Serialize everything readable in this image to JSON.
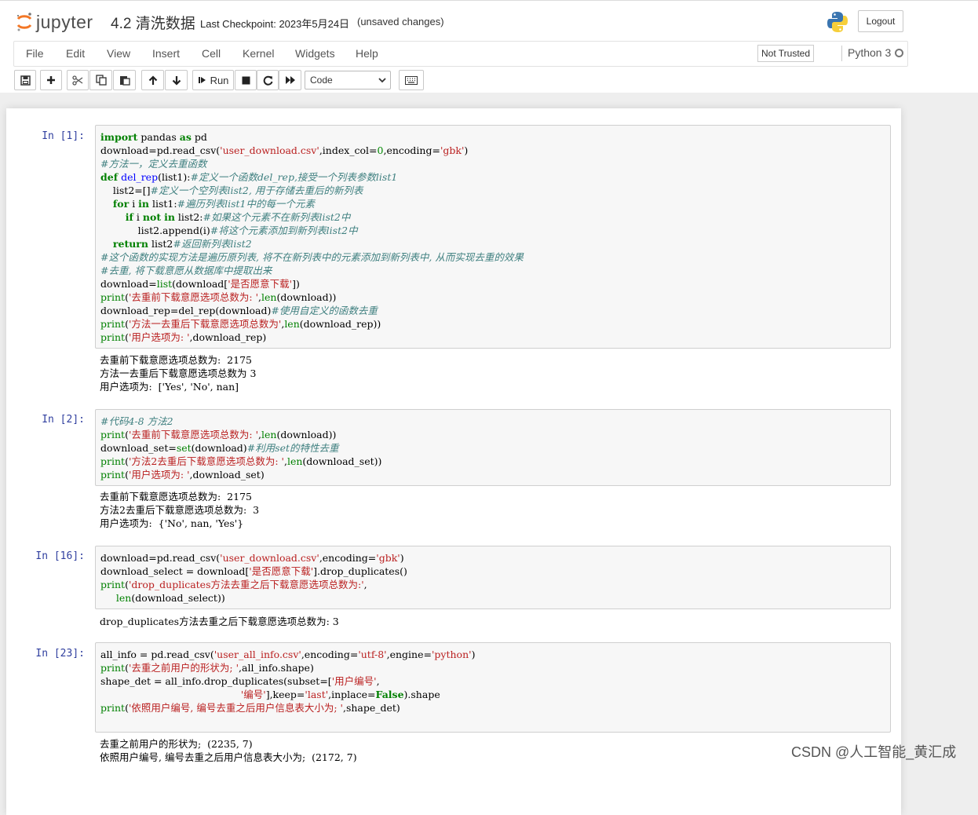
{
  "header": {
    "logo_text": "jupyter",
    "notebook_name": "4.2 清洗数据",
    "checkpoint": "Last Checkpoint: 2023年5月24日",
    "unsaved": "(unsaved changes)",
    "logout_label": "Logout"
  },
  "menu": {
    "items": [
      "File",
      "Edit",
      "View",
      "Insert",
      "Cell",
      "Kernel",
      "Widgets",
      "Help"
    ],
    "trusted": "Not Trusted",
    "kernel": "Python 3"
  },
  "toolbar": {
    "run_label": "Run",
    "cell_type": "Code"
  },
  "cells": [
    {
      "prompt": "In  [1]:",
      "code": [
        [
          [
            "k",
            "import"
          ],
          [
            "n",
            " pandas "
          ],
          [
            "k",
            "as"
          ],
          [
            "n",
            " pd"
          ]
        ],
        [
          [
            "n",
            "download=pd.read_csv("
          ],
          [
            "s",
            "'user_download.csv'"
          ],
          [
            "n",
            ",index_col="
          ],
          [
            "num",
            "0"
          ],
          [
            "n",
            ",encoding="
          ],
          [
            "s",
            "'gbk'"
          ],
          [
            "n",
            ")"
          ]
        ],
        [
          [
            "c",
            "#方法一，定义去重函数"
          ]
        ],
        [
          [
            "k",
            "def"
          ],
          [
            "n",
            " "
          ],
          [
            "f",
            "del_rep"
          ],
          [
            "n",
            "(list1):"
          ],
          [
            "c",
            "#定义一个函数del_rep,接受一个列表参数list1"
          ]
        ],
        [
          [
            "n",
            "    list2=[]"
          ],
          [
            "c",
            "#定义一个空列表list2, 用于存储去重后的新列表"
          ]
        ],
        [
          [
            "n",
            "    "
          ],
          [
            "k",
            "for"
          ],
          [
            "n",
            " i "
          ],
          [
            "k",
            "in"
          ],
          [
            "n",
            " list1:"
          ],
          [
            "c",
            "#遍历列表list1中的每一个元素"
          ]
        ],
        [
          [
            "n",
            "        "
          ],
          [
            "k",
            "if"
          ],
          [
            "n",
            " i "
          ],
          [
            "k",
            "not"
          ],
          [
            "n",
            " "
          ],
          [
            "k",
            "in"
          ],
          [
            "n",
            " list2:"
          ],
          [
            "c",
            "#如果这个元素不在新列表list2中"
          ]
        ],
        [
          [
            "n",
            "            list2.append(i)"
          ],
          [
            "c",
            "#将这个元素添加到新列表list2中"
          ]
        ],
        [
          [
            "n",
            "    "
          ],
          [
            "k",
            "return"
          ],
          [
            "n",
            " list2"
          ],
          [
            "c",
            "#返回新列表list2"
          ]
        ],
        [
          [
            "c",
            "#这个函数的实现方法是遍历原列表, 将不在新列表中的元素添加到新列表中, 从而实现去重的效果"
          ]
        ],
        [
          [
            "c",
            "#去重, 将下载意愿从数据库中提取出来"
          ]
        ],
        [
          [
            "n",
            "download="
          ],
          [
            "b",
            "list"
          ],
          [
            "n",
            "(download["
          ],
          [
            "s",
            "'是否愿意下载'"
          ],
          [
            "n",
            "])"
          ]
        ],
        [
          [
            "b",
            "print"
          ],
          [
            "n",
            "("
          ],
          [
            "s",
            "'去重前下载意愿选项总数为: '"
          ],
          [
            "n",
            ","
          ],
          [
            "b",
            "len"
          ],
          [
            "n",
            "(download))"
          ]
        ],
        [
          [
            "n",
            "download_rep=del_rep(download)"
          ],
          [
            "c",
            "#使用自定义的函数去重"
          ]
        ],
        [
          [
            "b",
            "print"
          ],
          [
            "n",
            "("
          ],
          [
            "s",
            "'方法一去重后下载意愿选项总数为'"
          ],
          [
            "n",
            ","
          ],
          [
            "b",
            "len"
          ],
          [
            "n",
            "(download_rep))"
          ]
        ],
        [
          [
            "b",
            "print"
          ],
          [
            "n",
            "("
          ],
          [
            "s",
            "'用户选项为: '"
          ],
          [
            "n",
            ",download_rep)"
          ]
        ]
      ],
      "output": [
        "去重前下载意愿选项总数为:  2175",
        "方法一去重后下载意愿选项总数为 3",
        "用户选项为:  ['Yes', 'No', nan]"
      ]
    },
    {
      "prompt": "In  [2]:",
      "code": [
        [
          [
            "c",
            "#代码4-8 方法2"
          ]
        ],
        [
          [
            "b",
            "print"
          ],
          [
            "n",
            "("
          ],
          [
            "s",
            "'去重前下载意愿选项总数为: '"
          ],
          [
            "n",
            ","
          ],
          [
            "b",
            "len"
          ],
          [
            "n",
            "(download))"
          ]
        ],
        [
          [
            "n",
            "download_set="
          ],
          [
            "b",
            "set"
          ],
          [
            "n",
            "(download)"
          ],
          [
            "c",
            "#利用set的特性去重"
          ]
        ],
        [
          [
            "b",
            "print"
          ],
          [
            "n",
            "("
          ],
          [
            "s",
            "'方法2去重后下载意愿选项总数为: '"
          ],
          [
            "n",
            ","
          ],
          [
            "b",
            "len"
          ],
          [
            "n",
            "(download_set))"
          ]
        ],
        [
          [
            "b",
            "print"
          ],
          [
            "n",
            "("
          ],
          [
            "s",
            "'用户选项为: '"
          ],
          [
            "n",
            ",download_set)"
          ]
        ]
      ],
      "output": [
        "去重前下载意愿选项总数为:  2175",
        "方法2去重后下载意愿选项总数为:  3",
        "用户选项为:  {'No', nan, 'Yes'}"
      ]
    },
    {
      "prompt": "In  [16]:",
      "code": [
        [
          [
            "n",
            "download=pd.read_csv("
          ],
          [
            "s",
            "'user_download.csv'"
          ],
          [
            "n",
            ",encoding="
          ],
          [
            "s",
            "'gbk'"
          ],
          [
            "n",
            ")"
          ]
        ],
        [
          [
            "n",
            "download_select = download["
          ],
          [
            "s",
            "'是否愿意下载'"
          ],
          [
            "n",
            "].drop_duplicates()"
          ]
        ],
        [
          [
            "b",
            "print"
          ],
          [
            "n",
            "("
          ],
          [
            "s",
            "'drop_duplicates方法去重之后下载意愿选项总数为:'"
          ],
          [
            "n",
            ","
          ]
        ],
        [
          [
            "n",
            "     "
          ],
          [
            "b",
            "len"
          ],
          [
            "n",
            "(download_select))"
          ]
        ]
      ],
      "output": [
        "drop_duplicates方法去重之后下载意愿选项总数为: 3"
      ]
    },
    {
      "prompt": "In  [23]:",
      "code": [
        [
          [
            "n",
            "all_info = pd.read_csv("
          ],
          [
            "s",
            "'user_all_info.csv'"
          ],
          [
            "n",
            ",encoding="
          ],
          [
            "s",
            "'utf-8'"
          ],
          [
            "n",
            ",engine="
          ],
          [
            "s",
            "'python'"
          ],
          [
            "n",
            ")"
          ]
        ],
        [
          [
            "b",
            "print"
          ],
          [
            "n",
            "("
          ],
          [
            "s",
            "'去重之前用户的形状为; '"
          ],
          [
            "n",
            ",all_info.shape)"
          ]
        ],
        [
          [
            "n",
            "shape_det = all_info.drop_duplicates(subset=["
          ],
          [
            "s",
            "'用户编号'"
          ],
          [
            "n",
            ","
          ]
        ],
        [
          [
            "n",
            "                                             "
          ],
          [
            "s",
            "'编号'"
          ],
          [
            "n",
            "],keep="
          ],
          [
            "s",
            "'last'"
          ],
          [
            "n",
            ",inplace="
          ],
          [
            "k",
            "False"
          ],
          [
            "n",
            ").shape"
          ]
        ],
        [
          [
            "b",
            "print"
          ],
          [
            "n",
            "("
          ],
          [
            "s",
            "'依照用户编号, 编号去重之后用户信息表大小为; '"
          ],
          [
            "n",
            ",shape_det)"
          ]
        ]
      ],
      "output": [
        "去重之前用户的形状为;  (2235, 7)",
        "依照用户编号, 编号去重之后用户信息表大小为;  (2172, 7)"
      ]
    }
  ],
  "watermark": "CSDN @人工智能_黄汇成"
}
